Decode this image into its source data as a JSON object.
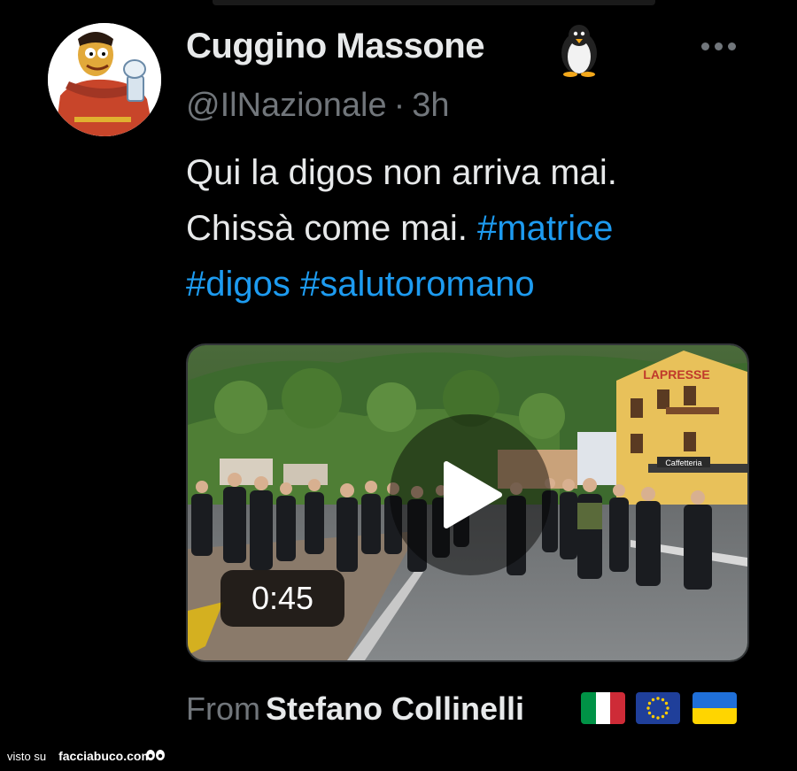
{
  "tweet": {
    "display_name": "Cuggino Massone",
    "badge_icon": "penguin-icon",
    "handle": "@IlNazionale",
    "separator": "·",
    "time": "3h",
    "text_line1": "Qui la digos non arriva mai.",
    "text_line2": "Chissà come mai.",
    "hashtags": [
      "#matrice",
      "#digos",
      "#salutoromano"
    ],
    "more_icon": "more-dots-icon"
  },
  "media": {
    "type": "video",
    "duration": "0:45",
    "overlay_watermark": "LAPRESSE",
    "shop_sign": "Caffetteria",
    "play_icon": "play-icon"
  },
  "attribution": {
    "prefix": "From",
    "author": "Stefano Collinelli",
    "flags": [
      "italy-flag-icon",
      "eu-flag-icon",
      "ukraine-flag-icon"
    ]
  },
  "watermark": {
    "label": "visto su",
    "site": "facciabuco.com"
  },
  "colors": {
    "background": "#000000",
    "primary_text": "#e7e9ea",
    "secondary_text": "#71767b",
    "link": "#1d9bf0"
  }
}
